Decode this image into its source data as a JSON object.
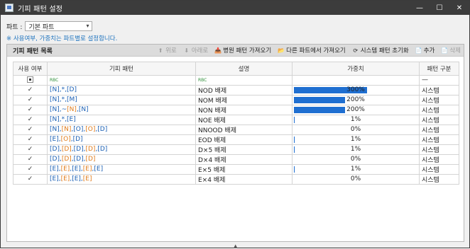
{
  "window": {
    "title": "기피 패턴 설정",
    "controls": [
      "—",
      "☐",
      "✕"
    ]
  },
  "part": {
    "label": "파트 :",
    "selected": "기본 파트"
  },
  "notice": "※ 사용여부, 가중치는 파트별로 설정합니다.",
  "panel": {
    "title": "기피 패턴 목록",
    "toolbar": [
      {
        "label": "위로",
        "icon": "up-arrow-icon",
        "glyph": "⬆",
        "disabled": true
      },
      {
        "label": "아래로",
        "icon": "down-arrow-icon",
        "glyph": "⬇",
        "disabled": true
      },
      {
        "label": "병원 패턴 가져오기",
        "icon": "import-box-icon",
        "glyph": "📥",
        "disabled": false
      },
      {
        "label": "다른 파트에서 가져오기",
        "icon": "folder-icon",
        "glyph": "📂",
        "disabled": false
      },
      {
        "label": "시스템 패턴 초기화",
        "icon": "refresh-icon",
        "glyph": "⟳",
        "disabled": false
      },
      {
        "label": "추가",
        "icon": "add-document-icon",
        "glyph": "📄",
        "disabled": false
      },
      {
        "label": "삭제",
        "icon": "delete-document-icon",
        "glyph": "📄",
        "disabled": true
      }
    ]
  },
  "table": {
    "columns": [
      "사용 여부",
      "기피 패턴",
      "설명",
      "가중치",
      "패턴 구분"
    ],
    "filter": {
      "pattern_icon": "RBC",
      "desc_icon": "RBC",
      "category": "—"
    },
    "rows": [
      {
        "used": true,
        "pattern": [
          {
            "t": "[N]",
            "c": "b"
          },
          {
            "t": ",*,",
            "c": "b"
          },
          {
            "t": "[D]",
            "c": "b"
          }
        ],
        "desc": "NOD 배제",
        "weight": "300%",
        "weight_fill": 1.0,
        "category": "시스템"
      },
      {
        "used": true,
        "pattern": [
          {
            "t": "[N]",
            "c": "b"
          },
          {
            "t": ",*,",
            "c": "b"
          },
          {
            "t": "[M]",
            "c": "b"
          }
        ],
        "desc": "NOM 배제",
        "weight": "200%",
        "weight_fill": 0.7,
        "category": "시스템"
      },
      {
        "used": true,
        "pattern": [
          {
            "t": "[N]",
            "c": "b"
          },
          {
            "t": ",~",
            "c": "b"
          },
          {
            "t": "[N]",
            "c": "o"
          },
          {
            "t": ",",
            "c": "b"
          },
          {
            "t": "[N]",
            "c": "b"
          }
        ],
        "desc": "NON 배제",
        "weight": "200%",
        "weight_fill": 0.7,
        "category": "시스템"
      },
      {
        "used": true,
        "pattern": [
          {
            "t": "[N]",
            "c": "b"
          },
          {
            "t": ",*,",
            "c": "b"
          },
          {
            "t": "[E]",
            "c": "b"
          }
        ],
        "desc": "NOE 배제",
        "weight": "1%",
        "weight_fill": 0.01,
        "category": "시스템"
      },
      {
        "used": true,
        "pattern": [
          {
            "t": "[N]",
            "c": "b"
          },
          {
            "t": ",",
            "c": "b"
          },
          {
            "t": "[N]",
            "c": "o"
          },
          {
            "t": ",",
            "c": "b"
          },
          {
            "t": "[O]",
            "c": "b"
          },
          {
            "t": ",",
            "c": "b"
          },
          {
            "t": "[O]",
            "c": "o"
          },
          {
            "t": ",",
            "c": "b"
          },
          {
            "t": "[D]",
            "c": "b"
          }
        ],
        "desc": "NNOOD 배제",
        "weight": "0%",
        "weight_fill": 0,
        "category": "시스템"
      },
      {
        "used": true,
        "pattern": [
          {
            "t": "[E]",
            "c": "b"
          },
          {
            "t": ",",
            "c": "b"
          },
          {
            "t": "[O]",
            "c": "o"
          },
          {
            "t": ",",
            "c": "b"
          },
          {
            "t": "[D]",
            "c": "b"
          }
        ],
        "desc": "EOD 배제",
        "weight": "1%",
        "weight_fill": 0.01,
        "category": "시스템"
      },
      {
        "used": true,
        "pattern": [
          {
            "t": "[D]",
            "c": "b"
          },
          {
            "t": ",",
            "c": "b"
          },
          {
            "t": "[D]",
            "c": "o"
          },
          {
            "t": ",",
            "c": "b"
          },
          {
            "t": "[D]",
            "c": "b"
          },
          {
            "t": ",",
            "c": "b"
          },
          {
            "t": "[D]",
            "c": "o"
          },
          {
            "t": ",",
            "c": "b"
          },
          {
            "t": "[D]",
            "c": "b"
          }
        ],
        "desc": "D×5 배제",
        "weight": "1%",
        "weight_fill": 0.01,
        "category": "시스템"
      },
      {
        "used": true,
        "pattern": [
          {
            "t": "[D]",
            "c": "b"
          },
          {
            "t": ",",
            "c": "b"
          },
          {
            "t": "[D]",
            "c": "o"
          },
          {
            "t": ",",
            "c": "b"
          },
          {
            "t": "[D]",
            "c": "b"
          },
          {
            "t": ",",
            "c": "b"
          },
          {
            "t": "[D]",
            "c": "o"
          }
        ],
        "desc": "D×4 배제",
        "weight": "0%",
        "weight_fill": 0,
        "category": "시스템"
      },
      {
        "used": true,
        "pattern": [
          {
            "t": "[E]",
            "c": "b"
          },
          {
            "t": ",",
            "c": "b"
          },
          {
            "t": "[E]",
            "c": "o"
          },
          {
            "t": ",",
            "c": "b"
          },
          {
            "t": "[E]",
            "c": "b"
          },
          {
            "t": ",",
            "c": "b"
          },
          {
            "t": "[E]",
            "c": "o"
          },
          {
            "t": ",",
            "c": "b"
          },
          {
            "t": "[E]",
            "c": "b"
          }
        ],
        "desc": "E×5 배제",
        "weight": "1%",
        "weight_fill": 0.01,
        "category": "시스템"
      },
      {
        "used": true,
        "pattern": [
          {
            "t": "[E]",
            "c": "b"
          },
          {
            "t": ",",
            "c": "b"
          },
          {
            "t": "[E]",
            "c": "o"
          },
          {
            "t": ",",
            "c": "b"
          },
          {
            "t": "[E]",
            "c": "b"
          },
          {
            "t": ",",
            "c": "b"
          },
          {
            "t": "[E]",
            "c": "o"
          }
        ],
        "desc": "E×4 배제",
        "weight": "0%",
        "weight_fill": 0,
        "category": "시스템"
      }
    ]
  },
  "colors": {
    "accent": "#1f6fd1",
    "pattern_blue": "#1a5fb4",
    "pattern_orange": "#e07b1a",
    "notice": "#1e73be"
  }
}
